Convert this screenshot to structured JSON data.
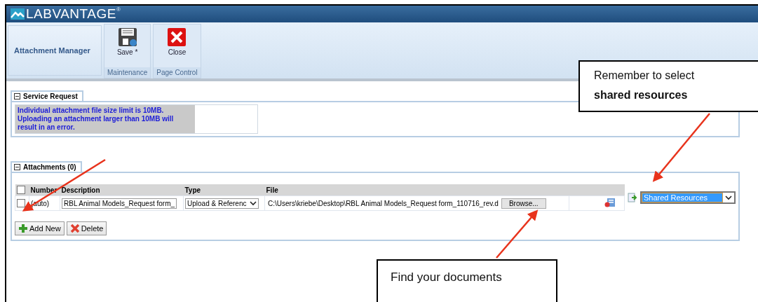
{
  "header": {
    "brand": "LABVANTAGE",
    "brand_mark": "®"
  },
  "toolbar": {
    "title": "Attachment Manager",
    "groups": [
      {
        "label": "Maintenance",
        "buttons": [
          {
            "label": "Save *",
            "kind": "save"
          }
        ]
      },
      {
        "label": "Page Control",
        "buttons": [
          {
            "label": "Close",
            "kind": "close"
          }
        ]
      }
    ]
  },
  "service_request": {
    "title": "Service Request",
    "expanded": true,
    "message": "Individual attachment file size limit is 10MB. Uploading an attachment larger than 10MB will result in an error."
  },
  "attachments": {
    "title": "Attachments (0)",
    "expanded": true,
    "select_all": {
      "checked": false
    },
    "columns": [
      "Number",
      "Description",
      "Type",
      "File"
    ],
    "rows": [
      {
        "checked": false,
        "number": "(auto)",
        "description": "RBL Animal Models_Request form_",
        "type": "Upload & Referenc",
        "file": "C:\\Users\\kriebe\\Desktop\\RBL Animal Models_Request form_110716_rev.d",
        "browse": "Browse...",
        "location": "Shared Resources"
      }
    ],
    "buttons": [
      {
        "label": "Add New",
        "kind": "add"
      },
      {
        "label": "Delete",
        "kind": "delete"
      }
    ]
  },
  "callouts": [
    {
      "text": "Remember to select **shared resources**",
      "kind": "top"
    },
    {
      "text": "Find your documents",
      "kind": "bottom"
    }
  ]
}
